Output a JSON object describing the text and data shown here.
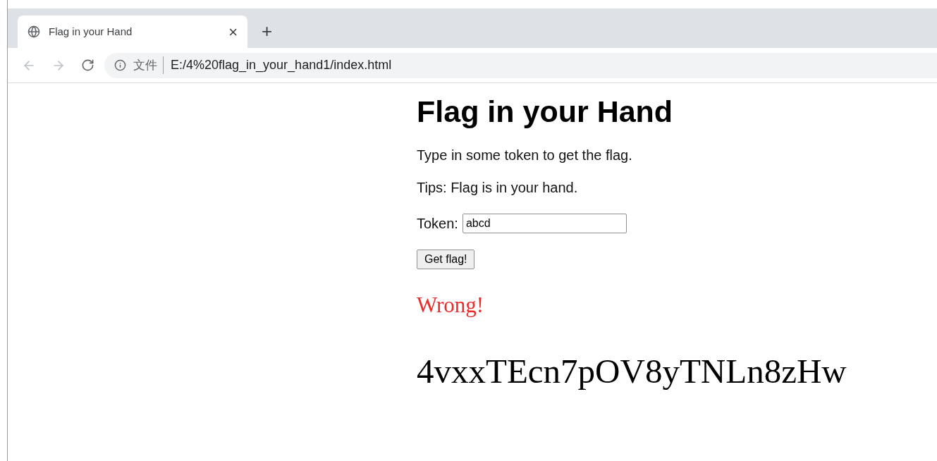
{
  "tab": {
    "title": "Flag in your Hand",
    "close": "×",
    "new_tab": "+"
  },
  "address_bar": {
    "scheme_label": "文件",
    "url": "E:/4%20flag_in_your_hand1/index.html"
  },
  "page": {
    "heading": "Flag in your Hand",
    "paragraphs": [
      "Type in some token to get the flag.",
      "Tips: Flag is in your hand."
    ],
    "token_label": "Token:",
    "token_value": "abcd",
    "button": "Get flag!",
    "result": "Wrong!",
    "flag": "4vxxTEcn7pOV8yTNLn8zHw"
  }
}
